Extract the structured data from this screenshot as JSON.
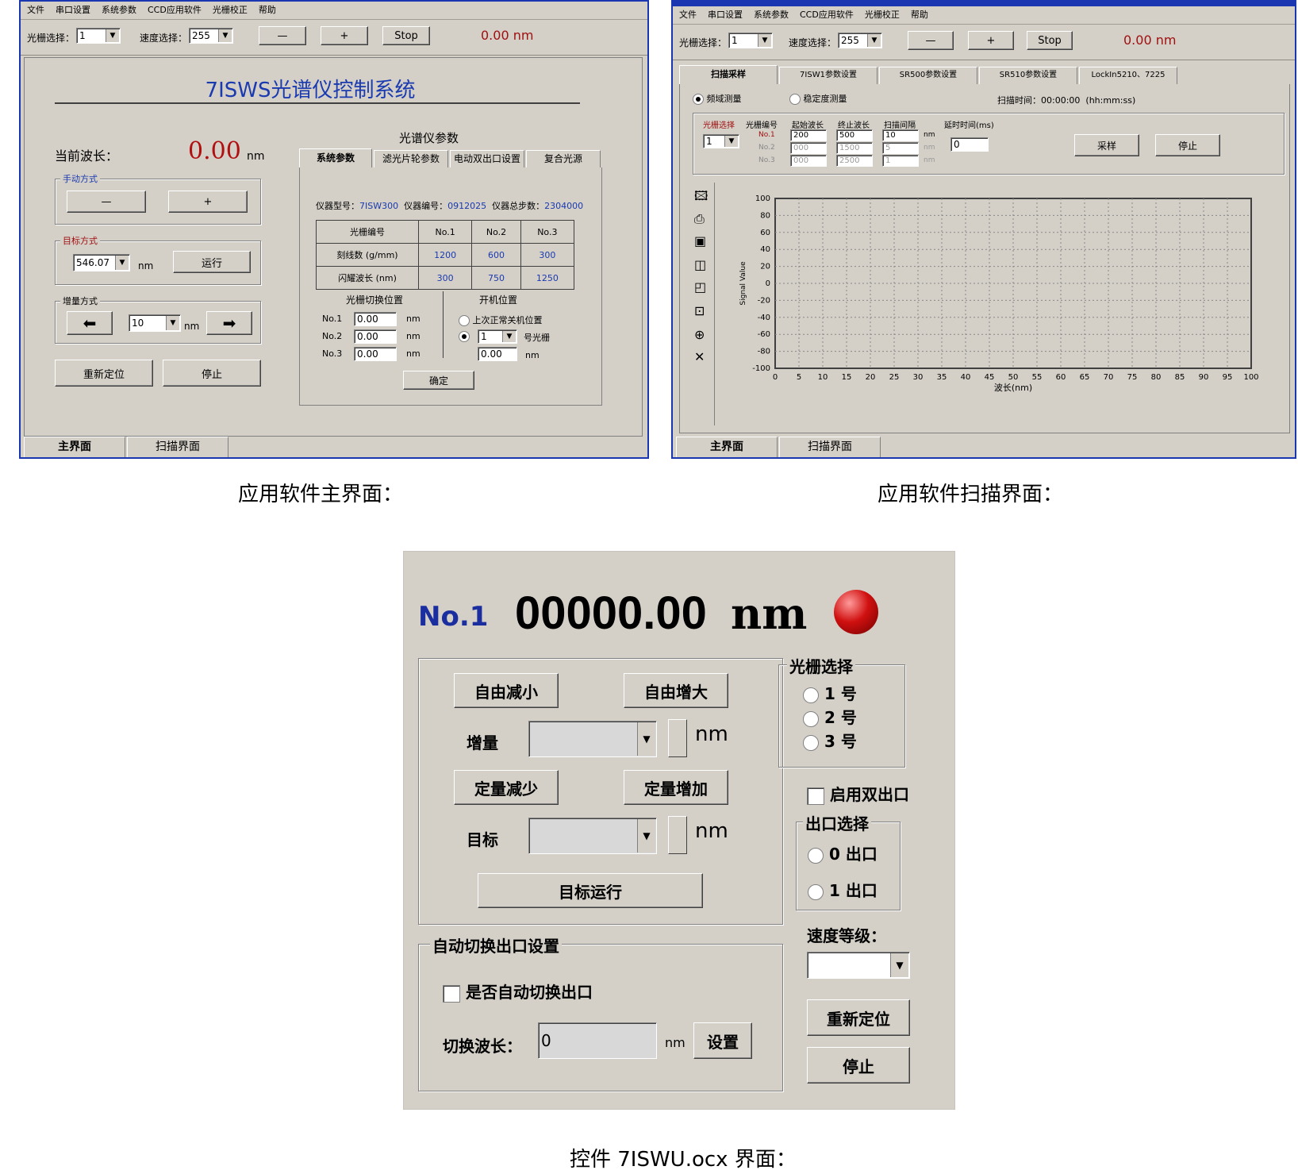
{
  "main_window": {
    "menu": [
      "文件",
      "串口设置",
      "系统参数",
      "CCD应用软件",
      "光栅校正",
      "帮助"
    ],
    "toolbar": {
      "grating_label": "光栅选择：",
      "grating_value": "1",
      "speed_label": "速度选择：",
      "speed_value": "255",
      "minus": "—",
      "plus": "+",
      "stop": "Stop",
      "readout": "0.00",
      "readout_unit": "nm"
    },
    "title": "7ISWS光谱仪控制系统",
    "current_label": "当前波长：",
    "current_value": "0.00",
    "current_unit": "nm",
    "manual": {
      "label": "手动方式",
      "minus": "—",
      "plus": "+"
    },
    "target": {
      "label": "目标方式",
      "value": "546.07",
      "unit": "nm",
      "run": "运行"
    },
    "increment": {
      "label": "增量方式",
      "value": "10",
      "unit": "nm"
    },
    "relocate": "重新定位",
    "stop": "停止",
    "params_title": "光谱仪参数",
    "param_tabs": [
      "系统参数",
      "滤光片轮参数",
      "电动双出口设置",
      "复合光源"
    ],
    "info": {
      "model_label": "仪器型号：",
      "model": "7ISW300",
      "serial_label": "仪器编号：",
      "serial": "0912025",
      "total_label": "仪器总步数：",
      "total": "2304000"
    },
    "grating_table": {
      "headers": [
        "光栅编号",
        "No.1",
        "No.2",
        "No.3"
      ],
      "rows": [
        [
          "刻线数 (g/mm)",
          "1200",
          "600",
          "300"
        ],
        [
          "闪耀波长 (nm)",
          "300",
          "750",
          "1250"
        ]
      ]
    },
    "switch_pos": {
      "title": "光栅切换位置",
      "rows": [
        [
          "No.1",
          "0.00",
          "nm"
        ],
        [
          "No.2",
          "0.00",
          "nm"
        ],
        [
          "No.3",
          "0.00",
          "nm"
        ]
      ]
    },
    "boot_pos": {
      "title": "开机位置",
      "opt1": "上次正常关机位置",
      "opt2_value": "1",
      "opt2_suffix": "号光栅",
      "value": "0.00",
      "unit": "nm"
    },
    "confirm": "确定",
    "bottom_tabs": [
      "主界面",
      "扫描界面"
    ]
  },
  "scan_window": {
    "menu": [
      "文件",
      "串口设置",
      "系统参数",
      "CCD应用软件",
      "光栅校正",
      "帮助"
    ],
    "toolbar": {
      "grating_label": "光栅选择：",
      "grating_value": "1",
      "speed_label": "速度选择：",
      "speed_value": "255",
      "minus": "—",
      "plus": "+",
      "stop": "Stop",
      "readout": "0.00",
      "readout_unit": "nm"
    },
    "tabs": [
      "扫描采样",
      "7ISW1参数设置",
      "SR500参数设置",
      "SR510参数设置",
      "LockIn5210、7225"
    ],
    "mode1": "频域测量",
    "mode2": "稳定度测量",
    "scan_time_label": "扫描时间：",
    "scan_time": "00:00:00",
    "scan_time_fmt": "(hh:mm:ss)",
    "headers": [
      "光栅选择",
      "光栅编号",
      "起始波长",
      "终止波长",
      "扫描间隔",
      "延时时间(ms)"
    ],
    "grating_select": "1",
    "rows": [
      [
        "No.1",
        "200",
        "500",
        "10"
      ],
      [
        "No.2",
        "000",
        "1500",
        "5"
      ],
      [
        "No.3",
        "000",
        "2500",
        "1"
      ]
    ],
    "unit": "nm",
    "delay": "0",
    "sample": "采样",
    "stop": "停止",
    "bottom_tabs": [
      "主界面",
      "扫描界面"
    ]
  },
  "chart_data": {
    "type": "line",
    "x": [],
    "series": [],
    "xlim": [
      0,
      100
    ],
    "ylim": [
      -100,
      100
    ],
    "xticks": [
      "0",
      "5",
      "10",
      "15",
      "20",
      "25",
      "30",
      "35",
      "40",
      "45",
      "50",
      "55",
      "60",
      "65",
      "70",
      "75",
      "80",
      "85",
      "90",
      "95",
      "100"
    ],
    "yticks": [
      "100",
      "80",
      "60",
      "40",
      "20",
      "0",
      "-20",
      "-40",
      "-60",
      "-80",
      "-100"
    ],
    "xlabel": "波长(nm)",
    "ylabel": "Signal Value",
    "grid": true
  },
  "ocx": {
    "channel": "No.1",
    "wavelength": "00000.00",
    "unit": "nm",
    "free_dec": "自由减小",
    "free_inc": "自由增大",
    "inc_label": "增量",
    "inc_unit": "nm",
    "fixed_dec": "定量减少",
    "fixed_inc": "定量增加",
    "target_label": "目标",
    "target_unit": "nm",
    "target_run": "目标运行",
    "grating_group": "光栅选择",
    "gratings": [
      "1 号",
      "2 号",
      "3 号"
    ],
    "dual_exit": "启用双出口",
    "exit_group": "出口选择",
    "exits": [
      "0 出口",
      "1 出口"
    ],
    "speed_label": "速度等级：",
    "relocate": "重新定位",
    "stop": "停止",
    "auto_group": "自动切换出口设置",
    "auto_check": "是否自动切换出口",
    "switch_label": "切换波长：",
    "switch_value": "0",
    "switch_unit": "nm",
    "set": "设置",
    "led_color": "#d01010"
  },
  "captions": {
    "main": "应用软件主界面：",
    "scan": "应用软件扫描界面：",
    "ocx": "控件 7ISWU.ocx 界面："
  }
}
